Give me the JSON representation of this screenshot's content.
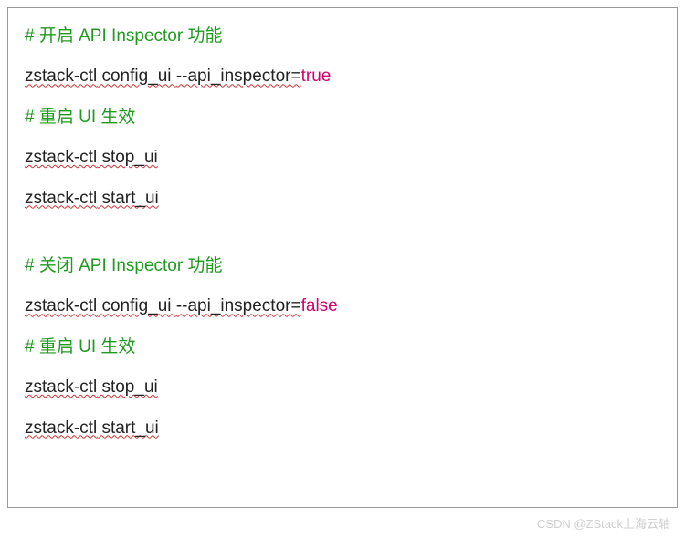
{
  "lines": {
    "c1_hash": "# ",
    "c1_text": "开启 API Inspector 功能",
    "l2_cmd": "zstack-ctl",
    "l2_sub": " config_ui ",
    "l2_flag": "--api_inspector=",
    "l2_val": "true",
    "c3_hash": "# ",
    "c3_text": "重启 UI 生效",
    "l4_cmd": "zstack-ctl",
    "l4_sub": " stop_ui",
    "l5_cmd": "zstack-ctl",
    "l5_sub": " start_ui",
    "c6_hash": "# ",
    "c6_text": "关闭 API Inspector 功能",
    "l7_cmd": "zstack-ctl",
    "l7_sub": " config_ui ",
    "l7_flag": "--api_inspector=",
    "l7_val": "false",
    "c8_hash": "# ",
    "c8_text": "重启 UI 生效",
    "l9_cmd": "zstack-ctl",
    "l9_sub": " stop_ui",
    "l10_cmd": "zstack-ctl",
    "l10_sub": " start_ui"
  },
  "watermark": "CSDN @ZStack上海云轴"
}
